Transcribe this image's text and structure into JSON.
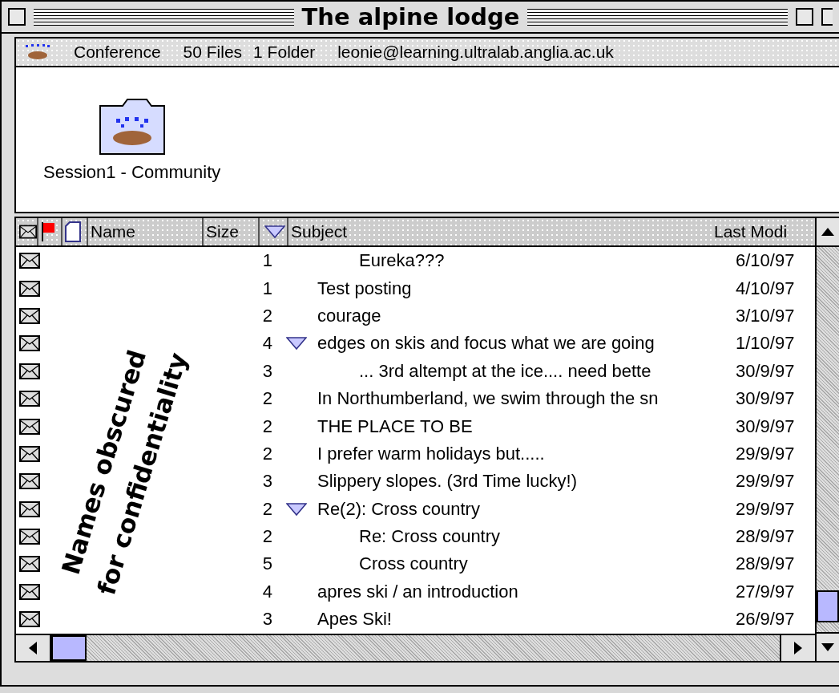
{
  "window": {
    "title": "The alpine lodge"
  },
  "info_bar": {
    "name": "Conference",
    "files": "50 Files",
    "folders": "1 Folder",
    "owner": "leonie@learning.ultralab.anglia.ac.uk"
  },
  "icons": [
    {
      "label": "Session1 - Community"
    }
  ],
  "table": {
    "columns": [
      "Name",
      "Size",
      "Subject",
      "Last Modi"
    ],
    "rows": [
      {
        "kind": "reply",
        "size": "1",
        "subject": "Eureka???",
        "date": "6/10/97"
      },
      {
        "kind": "post",
        "size": "1",
        "subject": "Test posting",
        "date": "4/10/97"
      },
      {
        "kind": "post",
        "size": "2",
        "subject": "courage",
        "date": "3/10/97"
      },
      {
        "kind": "post",
        "size": "4",
        "subject": "edges on skis and focus what we are going",
        "date": "1/10/97",
        "expanded": true,
        "children": [
          {
            "kind": "reply",
            "size": "3",
            "subject": "... 3rd altempt at the ice.... need bette",
            "date": "30/9/97"
          }
        ]
      },
      {
        "kind": "post",
        "size": "2",
        "subject": "In Northumberland, we swim through the sn",
        "date": "30/9/97"
      },
      {
        "kind": "post",
        "size": "2",
        "subject": "THE PLACE TO BE",
        "date": "30/9/97"
      },
      {
        "kind": "post",
        "size": "2",
        "subject": "I prefer warm holidays but.....",
        "date": "29/9/97"
      },
      {
        "kind": "post",
        "size": "3",
        "subject": "Slippery slopes. (3rd Time lucky!)",
        "date": "29/9/97"
      },
      {
        "kind": "post",
        "size": "2",
        "subject": "Re(2): Cross country",
        "date": "29/9/97",
        "expanded": true,
        "children": [
          {
            "kind": "reply",
            "size": "2",
            "subject": "Re: Cross country",
            "date": "28/9/97"
          },
          {
            "kind": "reply",
            "size": "5",
            "subject": "Cross country",
            "date": "28/9/97"
          }
        ]
      },
      {
        "kind": "post",
        "size": "4",
        "subject": "apres ski / an introduction",
        "date": "27/9/97"
      },
      {
        "kind": "post",
        "size": "3",
        "subject": "Apes Ski!",
        "date": "26/9/97"
      }
    ]
  },
  "annotation": "Names obscured for confidentiality"
}
